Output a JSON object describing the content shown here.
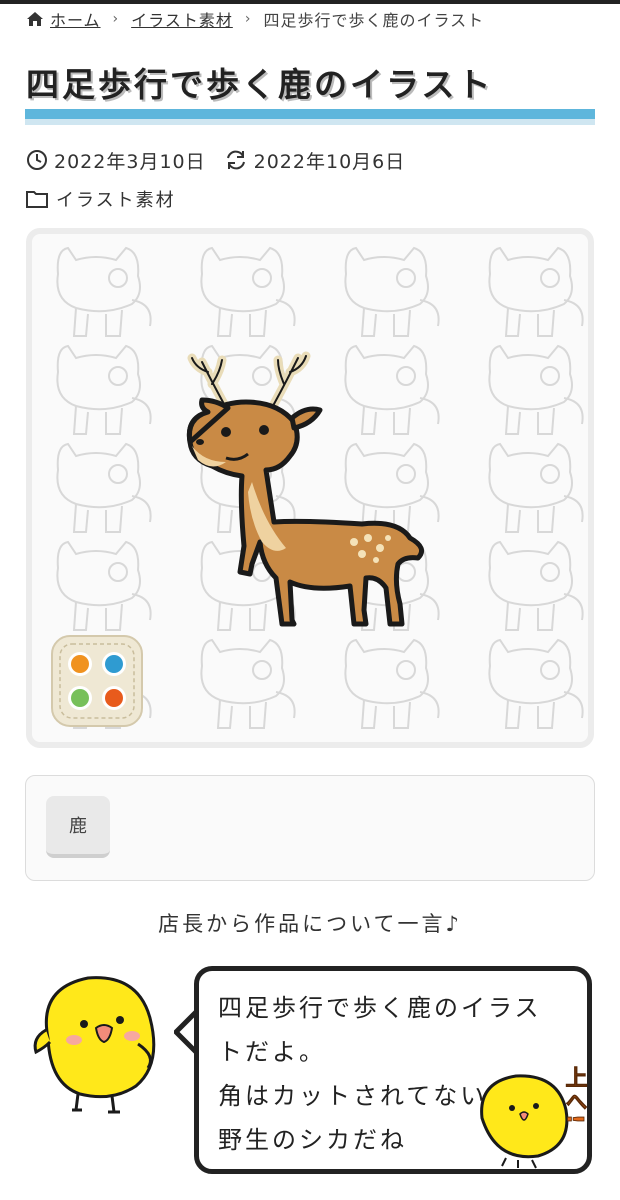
{
  "breadcrumb": {
    "home_label": "ホーム",
    "category_label": "イラスト素材",
    "current_label": "四足歩行で歩く鹿のイラスト"
  },
  "title": "四足歩行で歩く鹿のイラスト",
  "meta": {
    "published_date": "2022年3月10日",
    "updated_date": "2022年10月6日",
    "category": "イラスト素材"
  },
  "tags": [
    "鹿"
  ],
  "comment": {
    "heading": "店長から作品について一言♪",
    "text": "四足歩行で歩く鹿のイラストだよ。\n角はカットされてない\n野生のシカだね"
  },
  "back_to_top": {
    "label": "上へ!"
  },
  "colors": {
    "title_bar": "#5eb6dc",
    "deer_body": "#c98a45",
    "app_dots": [
      "#f0921f",
      "#2f9bd1",
      "#77c05a",
      "#e85b1c"
    ],
    "chick": "#ffe81a"
  },
  "icons": {
    "home": "home-icon",
    "clock": "clock-icon",
    "update": "refresh-icon",
    "folder": "folder-icon",
    "app": "app-icon"
  }
}
